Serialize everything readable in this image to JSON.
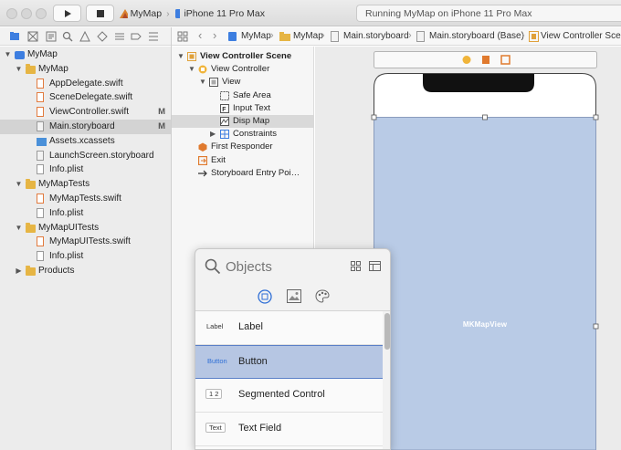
{
  "toolbar": {
    "scheme_name": "MyMap",
    "device": "iPhone 11 Pro Max",
    "status": "Running MyMap on iPhone 11 Pro Max"
  },
  "navigator": {
    "items": [
      {
        "label": "MyMap",
        "icon": "project-icon",
        "indent": 0,
        "disclosure": "open",
        "badge": "",
        "selected": false
      },
      {
        "label": "MyMap",
        "icon": "folder-icon",
        "indent": 1,
        "disclosure": "open",
        "badge": "",
        "selected": false
      },
      {
        "label": "AppDelegate.swift",
        "icon": "swift-file-icon",
        "indent": 2,
        "disclosure": "",
        "badge": "",
        "selected": false
      },
      {
        "label": "SceneDelegate.swift",
        "icon": "swift-file-icon",
        "indent": 2,
        "disclosure": "",
        "badge": "",
        "selected": false
      },
      {
        "label": "ViewController.swift",
        "icon": "swift-file-icon",
        "indent": 2,
        "disclosure": "",
        "badge": "M",
        "selected": false
      },
      {
        "label": "Main.storyboard",
        "icon": "storyboard-file-icon",
        "indent": 2,
        "disclosure": "",
        "badge": "M",
        "selected": true
      },
      {
        "label": "Assets.xcassets",
        "icon": "assets-icon",
        "indent": 2,
        "disclosure": "",
        "badge": "",
        "selected": false
      },
      {
        "label": "LaunchScreen.storyboard",
        "icon": "storyboard-file-icon",
        "indent": 2,
        "disclosure": "",
        "badge": "",
        "selected": false
      },
      {
        "label": "Info.plist",
        "icon": "plist-file-icon",
        "indent": 2,
        "disclosure": "",
        "badge": "",
        "selected": false
      },
      {
        "label": "MyMapTests",
        "icon": "folder-icon",
        "indent": 1,
        "disclosure": "open",
        "badge": "",
        "selected": false
      },
      {
        "label": "MyMapTests.swift",
        "icon": "swift-file-icon",
        "indent": 2,
        "disclosure": "",
        "badge": "",
        "selected": false
      },
      {
        "label": "Info.plist",
        "icon": "plist-file-icon",
        "indent": 2,
        "disclosure": "",
        "badge": "",
        "selected": false
      },
      {
        "label": "MyMapUITests",
        "icon": "folder-icon",
        "indent": 1,
        "disclosure": "open",
        "badge": "",
        "selected": false
      },
      {
        "label": "MyMapUITests.swift",
        "icon": "swift-file-icon",
        "indent": 2,
        "disclosure": "",
        "badge": "",
        "selected": false
      },
      {
        "label": "Info.plist",
        "icon": "plist-file-icon",
        "indent": 2,
        "disclosure": "",
        "badge": "",
        "selected": false
      },
      {
        "label": "Products",
        "icon": "folder-icon",
        "indent": 1,
        "disclosure": "closed",
        "badge": "",
        "selected": false
      }
    ]
  },
  "jumpbar": {
    "crumbs": [
      "MyMap",
      "MyMap",
      "Main.storyboard",
      "Main.storyboard (Base)",
      "View Controller Scene"
    ]
  },
  "outline": {
    "items": [
      {
        "label": "View Controller Scene",
        "icon": "scene-icon",
        "indent": 0,
        "disclosure": "open",
        "selected": false,
        "bold": true
      },
      {
        "label": "View Controller",
        "icon": "view-controller-icon",
        "indent": 1,
        "disclosure": "open",
        "selected": false,
        "bold": false
      },
      {
        "label": "View",
        "icon": "view-icon",
        "indent": 2,
        "disclosure": "open",
        "selected": false,
        "bold": false
      },
      {
        "label": "Safe Area",
        "icon": "safe-area-icon",
        "indent": 3,
        "disclosure": "",
        "selected": false,
        "bold": false
      },
      {
        "label": "Input Text",
        "icon": "text-field-icon",
        "indent": 3,
        "disclosure": "",
        "selected": false,
        "bold": false
      },
      {
        "label": "Disp Map",
        "icon": "map-view-icon",
        "indent": 3,
        "disclosure": "",
        "selected": true,
        "bold": false
      },
      {
        "label": "Constraints",
        "icon": "constraints-icon",
        "indent": 3,
        "disclosure": "closed",
        "selected": false,
        "bold": false
      },
      {
        "label": "First Responder",
        "icon": "first-responder-icon",
        "indent": 1,
        "disclosure": "",
        "selected": false,
        "bold": false
      },
      {
        "label": "Exit",
        "icon": "exit-icon",
        "indent": 1,
        "disclosure": "",
        "selected": false,
        "bold": false
      },
      {
        "label": "Storyboard Entry Poi…",
        "icon": "entry-arrow-icon",
        "indent": 1,
        "disclosure": "",
        "selected": false,
        "bold": false
      }
    ]
  },
  "canvas": {
    "map_label": "MKMapView",
    "map_color": "#b9cbe6"
  },
  "library": {
    "search_placeholder": "Objects",
    "items": [
      {
        "thumb": "Label",
        "name": "Label",
        "selected": false
      },
      {
        "thumb": "Button",
        "name": "Button",
        "selected": true
      },
      {
        "thumb": "1  2",
        "name": "Segmented Control",
        "selected": false
      },
      {
        "thumb": "Text",
        "name": "Text Field",
        "selected": false
      }
    ]
  },
  "colors": {
    "accent": "#2f6fd6",
    "selection": "#b6c6e3",
    "folder": "#e6b544"
  }
}
